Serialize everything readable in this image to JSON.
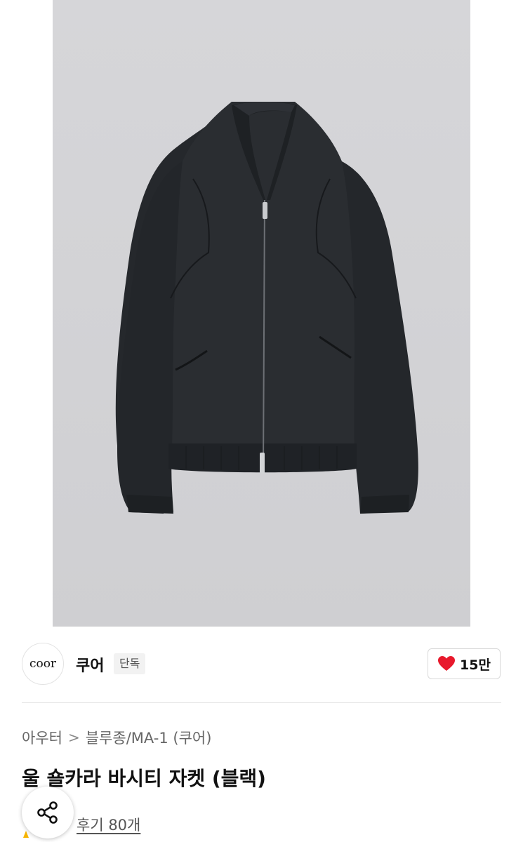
{
  "brand": {
    "logo_text": "coor",
    "name": "쿠어",
    "badge": "단독"
  },
  "like": {
    "count": "15만",
    "color": "#e8192c"
  },
  "breadcrumb": {
    "category": "아우터",
    "separator": ">",
    "subcategory": "블루종/MA-1 (쿠어)"
  },
  "product": {
    "title": "울 숄카라 바시티 자켓 (블랙)",
    "review_link": "후기 80개",
    "image_subject": "black wool varsity jacket with zipper"
  },
  "icons": {
    "like": "heart-icon",
    "share": "share-icon"
  }
}
